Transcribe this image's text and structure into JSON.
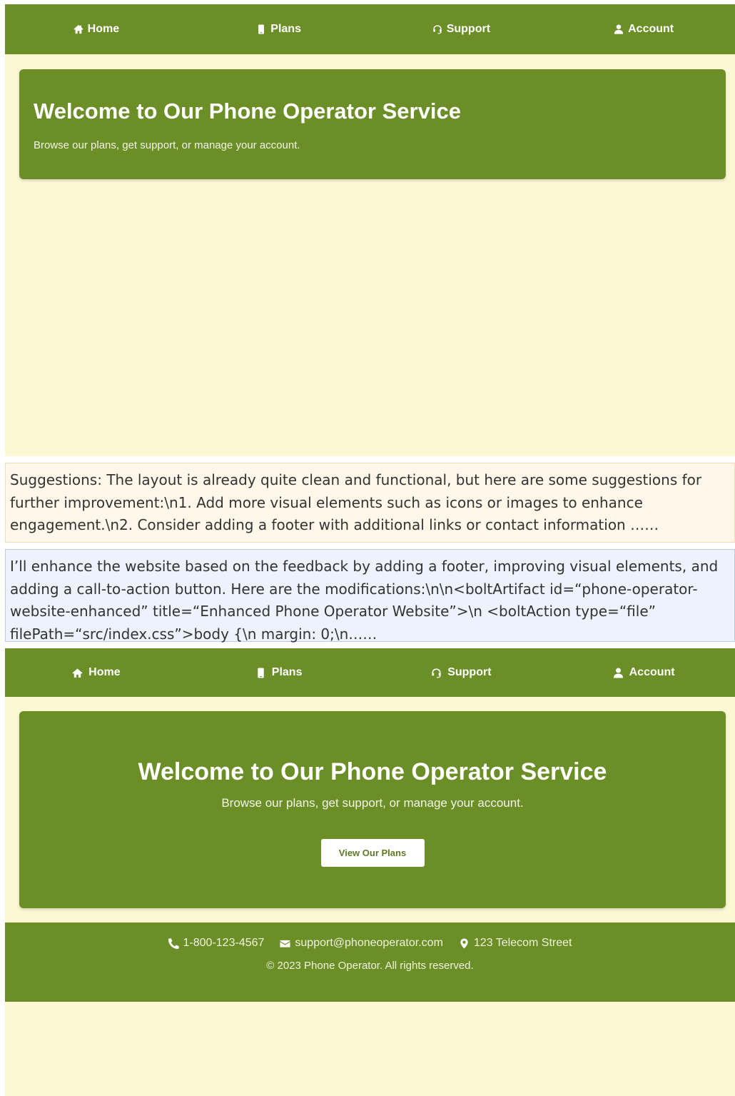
{
  "screen1": {
    "nav": [
      {
        "label": "Home",
        "icon": "home-icon"
      },
      {
        "label": "Plans",
        "icon": "phone-icon"
      },
      {
        "label": "Support",
        "icon": "headset-icon"
      },
      {
        "label": "Account",
        "icon": "user-icon"
      }
    ],
    "hero": {
      "title": "Welcome to Our Phone Operator Service",
      "subtitle": "Browse our plans, get support, or manage your account."
    }
  },
  "suggestions_text": "Suggestions: The layout is already quite clean and functional, but here are some suggestions for further improvement:\\n1. Add more visual elements such as icons or images to enhance engagement.\\n2. Consider adding a footer with additional links or contact information ……",
  "response_text": "I’ll enhance the website based on the feedback by adding a footer, improving visual elements, and adding a call-to-action button. Here are the modifications:\\n\\n<boltArtifact id=“phone-operator-website-enhanced” title=“Enhanced Phone Operator Website”>\\n  <boltAction type=“file” filePath=“src/index.css”>body {\\n  margin: 0;\\n……",
  "screen2": {
    "nav": [
      {
        "label": "Home",
        "icon": "home-icon"
      },
      {
        "label": "Plans",
        "icon": "phone-icon"
      },
      {
        "label": "Support",
        "icon": "headset-icon"
      },
      {
        "label": "Account",
        "icon": "user-icon"
      }
    ],
    "hero": {
      "title": "Welcome to Our Phone Operator Service",
      "subtitle": "Browse our plans, get support, or manage your account.",
      "cta_label": "View Our Plans"
    },
    "footer": {
      "phone": "1-800-123-4567",
      "email": "support@phoneoperator.com",
      "address": "123 Telecom Street",
      "copyright": "© 2023 Phone Operator. All rights reserved."
    }
  },
  "colors": {
    "primary_green": "#6b8e27",
    "page_background": "#fdf8d4",
    "suggestion_background": "#fff8ea",
    "response_background": "#eef2fc"
  }
}
